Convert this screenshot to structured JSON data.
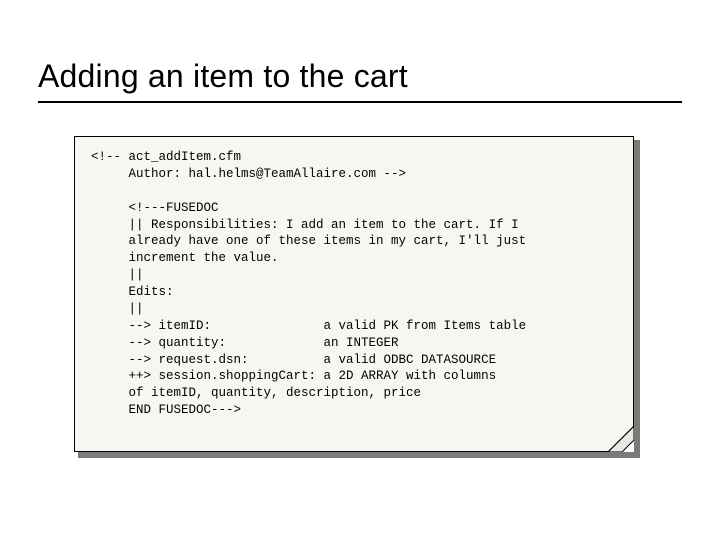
{
  "title": "Adding an item to the cart",
  "code": {
    "lines": [
      "<!-- act_addItem.cfm",
      "     Author: hal.helms@TeamAllaire.com -->",
      "",
      "     <!---FUSEDOC",
      "     || Responsibilities: I add an item to the cart. If I",
      "     already have one of these items in my cart, I'll just",
      "     increment the value.",
      "     ||",
      "     Edits:",
      "     ||",
      "     --> itemID:               a valid PK from Items table",
      "     --> quantity:             an INTEGER",
      "     --> request.dsn:          a valid ODBC DATASOURCE",
      "     ++> session.shoppingCart: a 2D ARRAY with columns",
      "     of itemID, quantity, description, price",
      "     END FUSEDOC--->"
    ]
  }
}
